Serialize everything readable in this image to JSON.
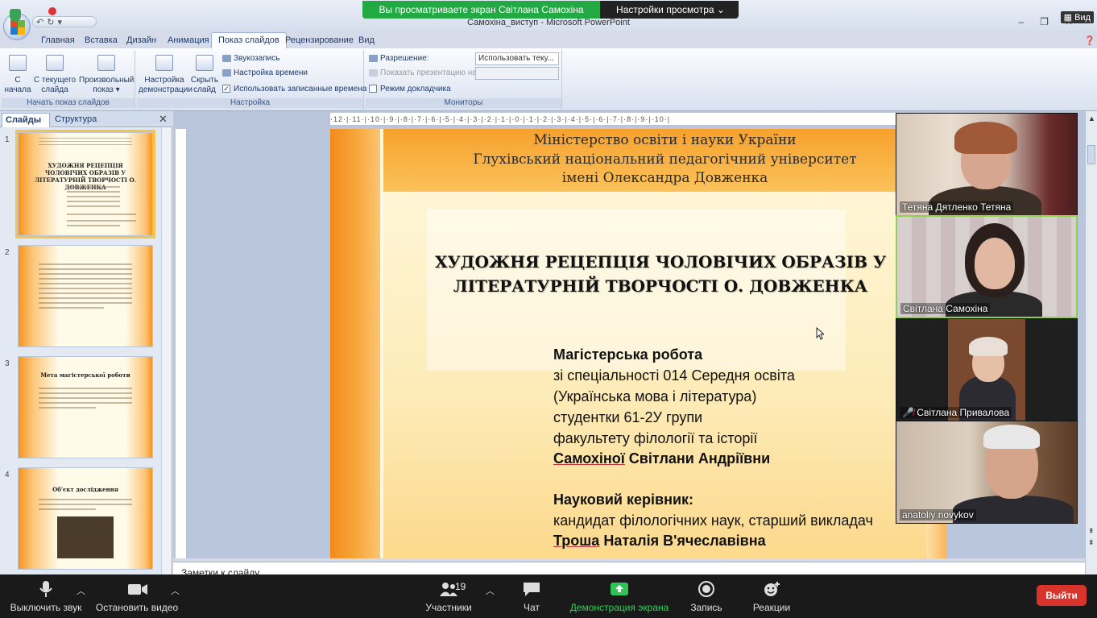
{
  "zoom": {
    "sharing_banner": "Вы просматриваете экран Світлана Самохіна",
    "view_settings": "Настройки просмотра",
    "view_label": "Вид",
    "toolbar": {
      "mute": "Выключить звук",
      "stop_video": "Остановить видео",
      "participants": "Участники",
      "participants_count": "19",
      "chat": "Чат",
      "share_screen": "Демонстрация экрана",
      "record": "Запись",
      "reactions": "Реакции",
      "leave": "Выйти"
    },
    "participants": [
      {
        "name": "Тетяна Дятленко Тетяна"
      },
      {
        "name": "Світлана Самохіна"
      },
      {
        "name": "Світлана Привалова"
      },
      {
        "name": "anatoliy novykov"
      }
    ]
  },
  "powerpoint": {
    "window_title": "Самохіна_виступ - Microsoft PowerPoint",
    "tabs": [
      "Главная",
      "Вставка",
      "Дизайн",
      "Анимация",
      "Показ слайдов",
      "Рецензирование",
      "Вид"
    ],
    "ribbon": {
      "start_group": "Начать показ слайдов",
      "from_start": "С начала",
      "from_current": "С текущего слайда",
      "custom_show": "Произвольный показ",
      "setup_group": "Настройка",
      "setup_show": "Настройка демонстрации",
      "hide_slide": "Скрыть слайд",
      "record_narration": "Звукозапись",
      "rehearse_timings": "Настройка времени",
      "use_timings": "Использовать записанные времена",
      "monitors_group": "Мониторы",
      "resolution_label": "Разрешение:",
      "resolution_value": "Использовать теку...",
      "show_on_label": "Показать презентацию на:",
      "presenter_view": "Режим докладчика"
    },
    "left_tabs": {
      "slides": "Слайды",
      "outline": "Структура"
    },
    "thumbnails": [
      {
        "num": "1",
        "title": "ХУДОЖНЯ РЕЦЕПЦІЯ ЧОЛОВІЧИХ ОБРАЗІВ У ЛІТЕРАТУРНІЙ ТВОРЧОСТІ О. ДОВЖЕНКА"
      },
      {
        "num": "2",
        "title": ""
      },
      {
        "num": "3",
        "title": "Мета магістерської роботи"
      },
      {
        "num": "4",
        "title": "Об'єкт дослідження"
      }
    ],
    "ruler_text": "·12·|·11·|·10·|·9·|·8·|·7·|·6·|·5·|·4·|·3·|·2·|·1·|·0·|·1·|·2·|·3·|·4·|·5·|·6·|·7·|·8·|·9·|·10·|",
    "notes_placeholder": "Заметки к слайду",
    "slide": {
      "header": [
        "Міністерство освіти і науки України",
        "Глухівський національний педагогічний університет",
        "імені Олександра Довженка"
      ],
      "title_line1": "ХУДОЖНЯ РЕЦЕПЦІЯ ЧОЛОВІЧИХ ОБРАЗІВ У",
      "title_line2": "ЛІТЕРАТУРНІЙ ТВОРЧОСТІ О. ДОВЖЕНКА",
      "work_type": "Магістерська робота",
      "spec": "зі спеціальності 014 Середня освіта",
      "spec2": "(Українська мова і література)",
      "group": "студентки 61-2У групи",
      "faculty": "факультету філології та історії",
      "author_surname": "Самохіної",
      "author_name": " Світлани Андріївни",
      "supervisor_label": "Науковий керівник:",
      "supervisor_title": "кандидат філологічних наук, старший викладач",
      "supervisor_surname": "Троша",
      "supervisor_name": " Наталія В'ячеславівна"
    }
  }
}
